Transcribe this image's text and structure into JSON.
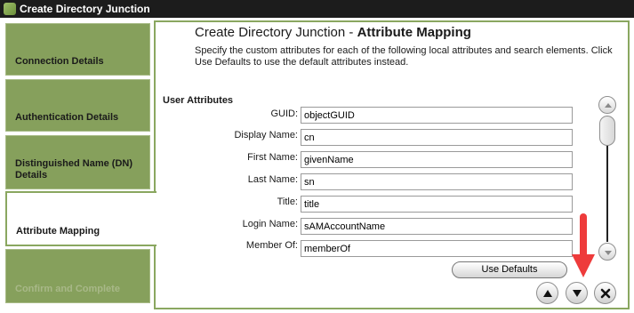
{
  "window": {
    "title": "Create Directory Junction"
  },
  "steps": [
    {
      "label": "Connection Details",
      "state": "normal"
    },
    {
      "label": "Authentication Details",
      "state": "normal"
    },
    {
      "label": "Distinguished Name (DN) Details",
      "state": "normal"
    },
    {
      "label": "Attribute Mapping",
      "state": "active"
    },
    {
      "label": "Confirm and Complete",
      "state": "disabled"
    }
  ],
  "header": {
    "title_prefix": "Create Directory Junction",
    "title_suffix": "Attribute Mapping",
    "intro": "Specify the custom attributes for each of the following local attributes and search elements. Click Use Defaults to use the default attributes instead."
  },
  "section": {
    "title": "User Attributes"
  },
  "attributes": [
    {
      "label": "GUID:",
      "value": "objectGUID"
    },
    {
      "label": "Display Name:",
      "value": "cn"
    },
    {
      "label": "First Name:",
      "value": "givenName"
    },
    {
      "label": "Last Name:",
      "value": "sn"
    },
    {
      "label": "Title:",
      "value": "title"
    },
    {
      "label": "Login Name:",
      "value": "sAMAccountName"
    },
    {
      "label": "Member Of:",
      "value": "memberOf"
    }
  ],
  "buttons": {
    "use_defaults": "Use Defaults"
  },
  "icons": {
    "scroll_up": "chevron-up-icon",
    "scroll_down": "chevron-down-icon",
    "nav_back": "triangle-up-icon",
    "nav_next": "triangle-down-icon",
    "close": "close-icon",
    "annotation": "red-arrow-icon"
  },
  "colors": {
    "accent": "#86a05c",
    "annotation": "#ee3b3b",
    "titlebar": "#1c1c1c"
  }
}
